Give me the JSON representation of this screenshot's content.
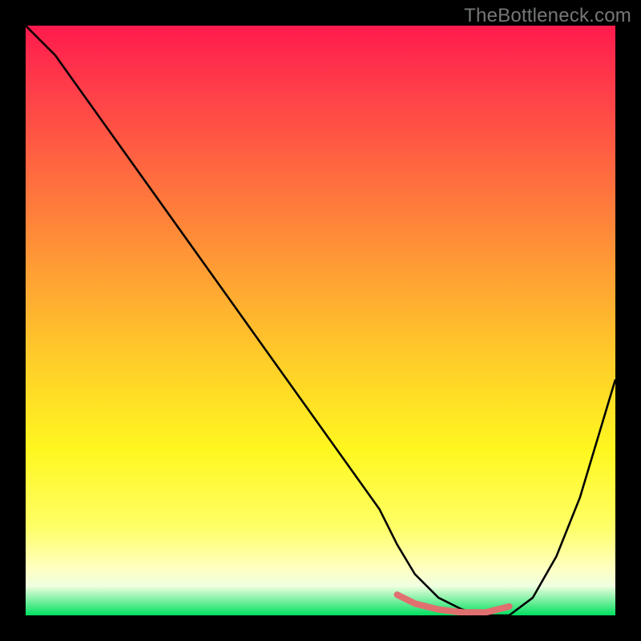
{
  "watermark": {
    "text": "TheBottleneck.com"
  },
  "chart_data": {
    "type": "line",
    "title": "",
    "xlabel": "",
    "ylabel": "",
    "xlim": [
      0,
      100
    ],
    "ylim": [
      0,
      100
    ],
    "background": {
      "type": "vertical-gradient",
      "stops": [
        {
          "pct": 0,
          "color": "#ff1a4d"
        },
        {
          "pct": 10,
          "color": "#ff3b4a"
        },
        {
          "pct": 25,
          "color": "#ff6a3f"
        },
        {
          "pct": 40,
          "color": "#ff9935"
        },
        {
          "pct": 55,
          "color": "#ffc82a"
        },
        {
          "pct": 72,
          "color": "#fff720"
        },
        {
          "pct": 85,
          "color": "#ffff66"
        },
        {
          "pct": 92,
          "color": "#ffffc0"
        },
        {
          "pct": 95,
          "color": "#f0ffe0"
        },
        {
          "pct": 100,
          "color": "#00e060"
        }
      ]
    },
    "series": [
      {
        "name": "main-curve",
        "color": "#000000",
        "x": [
          0,
          5,
          10,
          15,
          20,
          25,
          30,
          35,
          40,
          45,
          50,
          55,
          60,
          63,
          66,
          70,
          74,
          78,
          82,
          86,
          90,
          94,
          97,
          100
        ],
        "values": [
          100,
          95,
          88,
          81,
          74,
          67,
          60,
          53,
          46,
          39,
          32,
          25,
          18,
          12,
          7,
          3,
          1,
          0,
          0,
          3,
          10,
          20,
          30,
          40
        ]
      },
      {
        "name": "trough-highlight",
        "color": "#e07070",
        "x": [
          63,
          66,
          70,
          74,
          78,
          82
        ],
        "values": [
          3.5,
          2,
          1,
          0.5,
          0.5,
          1.5
        ]
      }
    ],
    "annotations": []
  }
}
